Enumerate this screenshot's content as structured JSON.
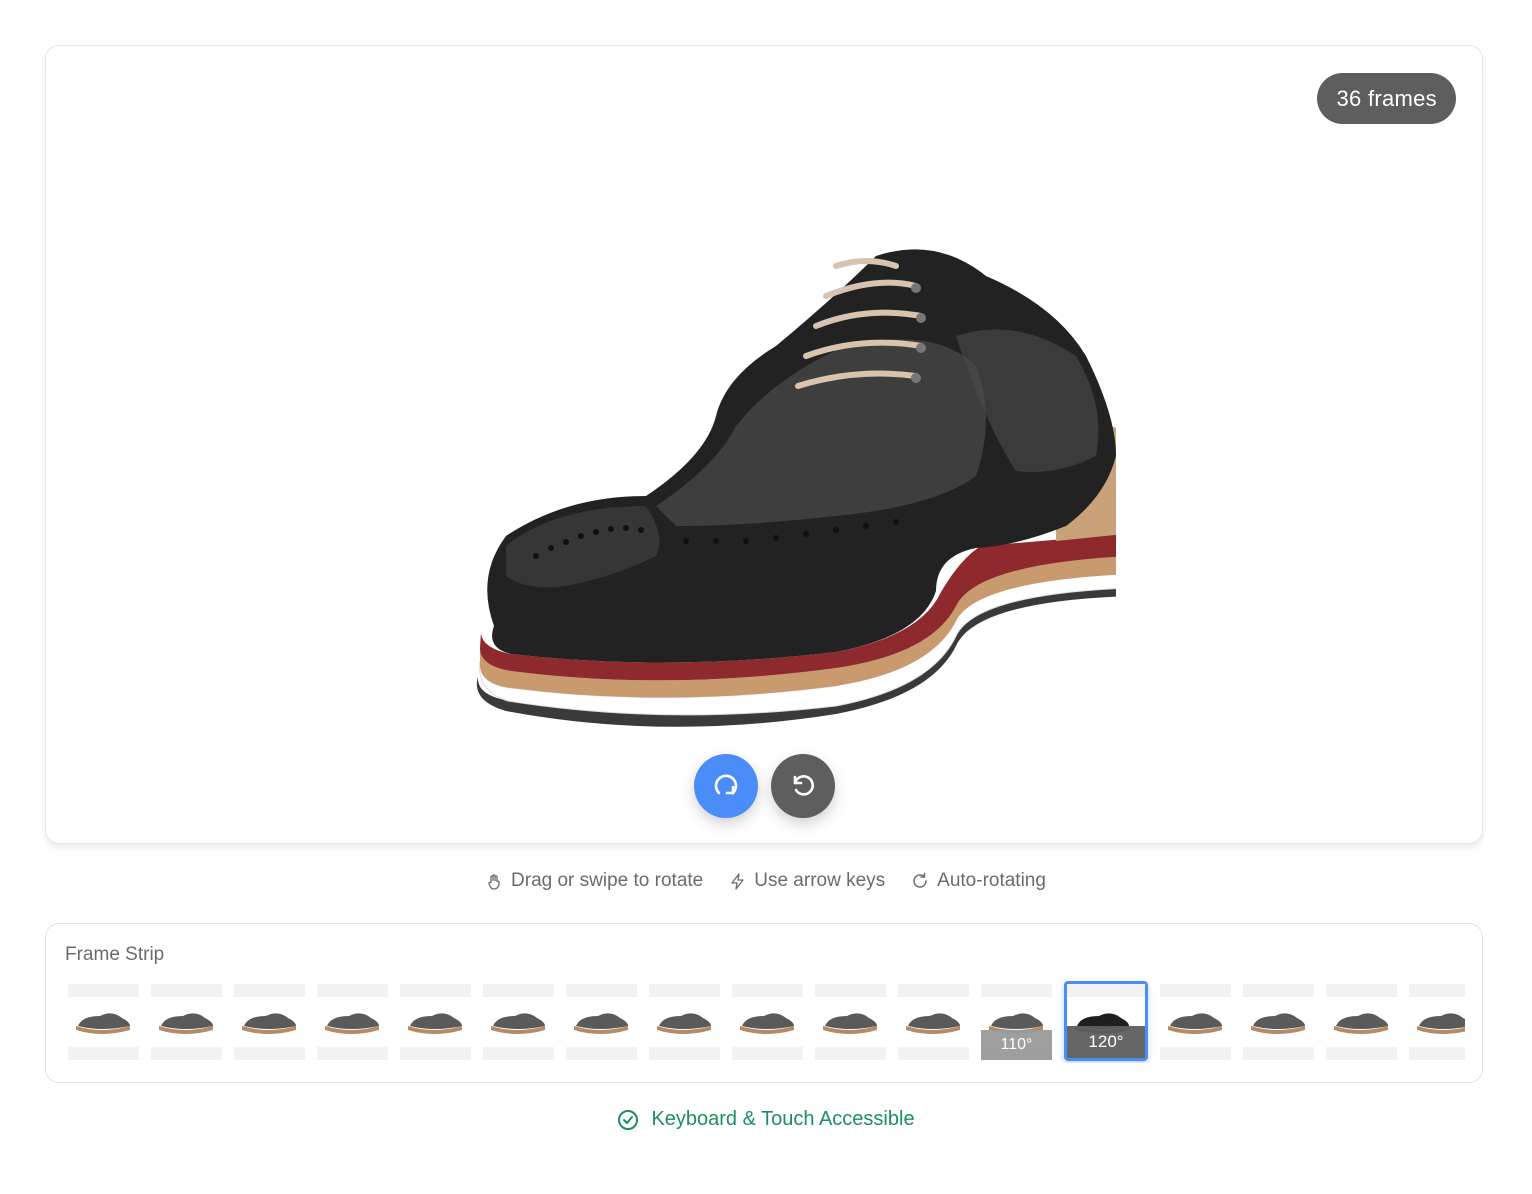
{
  "viewer": {
    "frames_badge": "36 frames",
    "shoe_alt": "black brogue shoe",
    "controls": {
      "play_icon": "auto-rotate-icon",
      "reset_icon": "reset-rotate-icon"
    }
  },
  "hints": [
    {
      "icon": "hand-icon",
      "label": "Drag or swipe to rotate"
    },
    {
      "icon": "lightning-icon",
      "label": "Use arrow keys"
    },
    {
      "icon": "refresh-icon",
      "label": "Auto-rotating"
    }
  ],
  "strip": {
    "title": "Frame Strip",
    "frames": [
      {
        "deg": ""
      },
      {
        "deg": ""
      },
      {
        "deg": ""
      },
      {
        "deg": ""
      },
      {
        "deg": ""
      },
      {
        "deg": ""
      },
      {
        "deg": ""
      },
      {
        "deg": ""
      },
      {
        "deg": ""
      },
      {
        "deg": ""
      },
      {
        "deg": ""
      },
      {
        "deg": "110°"
      },
      {
        "deg": "120°"
      },
      {
        "deg": ""
      },
      {
        "deg": ""
      },
      {
        "deg": ""
      },
      {
        "deg": ""
      }
    ],
    "active_frame_deg": "120°"
  },
  "accessibility": {
    "icon": "check-circle-icon",
    "label": "Keyboard & Touch Accessible"
  },
  "colors": {
    "accent": "#4b8df8",
    "dark": "#5e5e5e",
    "success": "#1d8f5c"
  }
}
